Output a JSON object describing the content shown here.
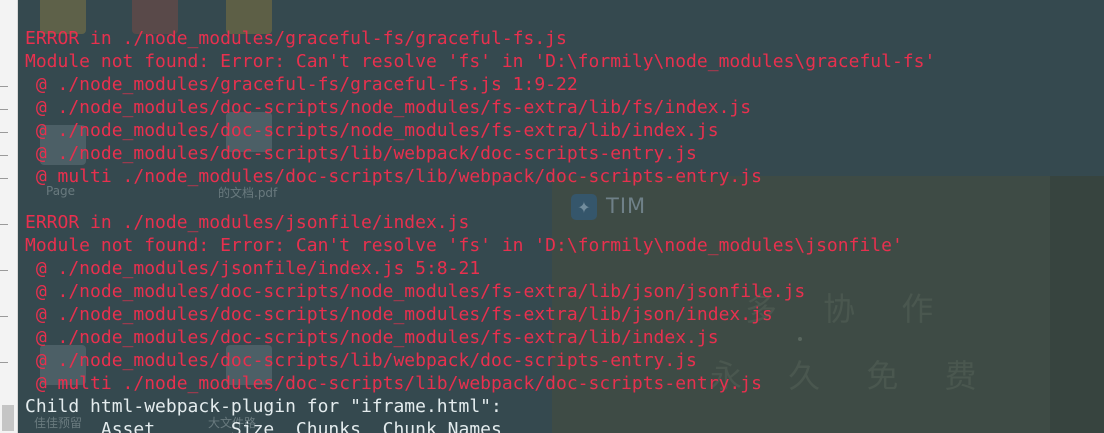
{
  "desktop": {
    "icons": [
      {
        "name": "desktop-icon-1",
        "color": "#c9a23a"
      },
      {
        "name": "desktop-icon-2",
        "color": "#b84a3a"
      },
      {
        "name": "desktop-icon-3",
        "color": "#c79a2e"
      }
    ],
    "labels": {
      "page": "Page",
      "pdf": "的文档.pdf",
      "bottom1": "佳佳预留",
      "bottom2": "大文件路"
    }
  },
  "tim": {
    "title": "TIM",
    "slogan_line1": "多 协 作",
    "slogan_line2": "永 久 免 费"
  },
  "terminal": {
    "lines": [
      {
        "text": "ERROR in ./node_modules/graceful-fs/graceful-fs.js",
        "style": "err"
      },
      {
        "text": "Module not found: Error: Can't resolve 'fs' in 'D:\\formily\\node_modules\\graceful-fs'",
        "style": "err"
      },
      {
        "text": " @ ./node_modules/graceful-fs/graceful-fs.js 1:9-22",
        "style": "err"
      },
      {
        "text": " @ ./node_modules/doc-scripts/node_modules/fs-extra/lib/fs/index.js",
        "style": "err"
      },
      {
        "text": " @ ./node_modules/doc-scripts/node_modules/fs-extra/lib/index.js",
        "style": "err"
      },
      {
        "text": " @ ./node_modules/doc-scripts/lib/webpack/doc-scripts-entry.js",
        "style": "err"
      },
      {
        "text": " @ multi ./node_modules/doc-scripts/lib/webpack/doc-scripts-entry.js",
        "style": "err"
      },
      {
        "text": "",
        "style": "err"
      },
      {
        "text": "ERROR in ./node_modules/jsonfile/index.js",
        "style": "err"
      },
      {
        "text": "Module not found: Error: Can't resolve 'fs' in 'D:\\formily\\node_modules\\jsonfile'",
        "style": "err"
      },
      {
        "text": " @ ./node_modules/jsonfile/index.js 5:8-21",
        "style": "err"
      },
      {
        "text": " @ ./node_modules/doc-scripts/node_modules/fs-extra/lib/json/jsonfile.js",
        "style": "err"
      },
      {
        "text": " @ ./node_modules/doc-scripts/node_modules/fs-extra/lib/json/index.js",
        "style": "err"
      },
      {
        "text": " @ ./node_modules/doc-scripts/node_modules/fs-extra/lib/index.js",
        "style": "err"
      },
      {
        "text": " @ ./node_modules/doc-scripts/lib/webpack/doc-scripts-entry.js",
        "style": "err"
      },
      {
        "text": " @ multi ./node_modules/doc-scripts/lib/webpack/doc-scripts-entry.js",
        "style": "err"
      },
      {
        "text": "Child html-webpack-plugin for \"iframe.html\":",
        "style": "normal"
      },
      {
        "text": "       Asset       Size  Chunks  Chunk Names",
        "style": "normal"
      }
    ]
  }
}
